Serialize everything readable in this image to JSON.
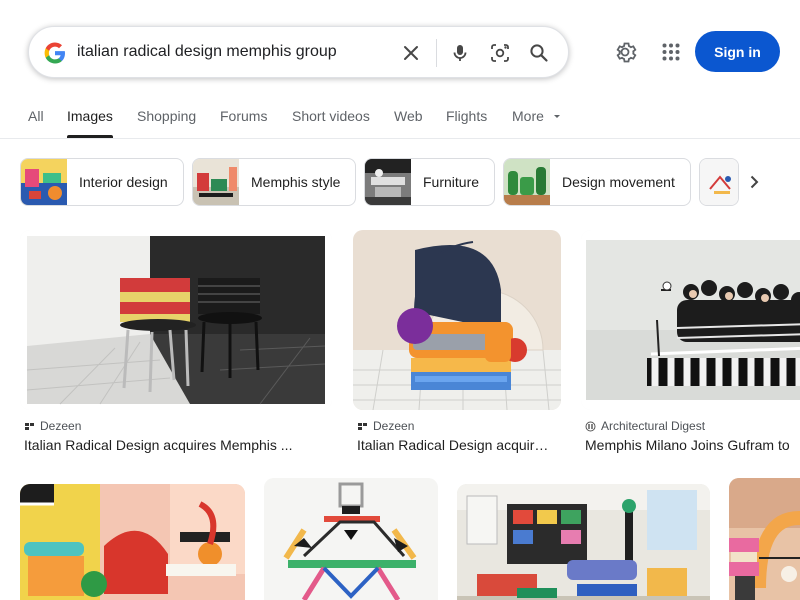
{
  "search": {
    "query": "italian radical design memphis group"
  },
  "header": {
    "signin_label": "Sign in"
  },
  "tabs": [
    {
      "label": "All"
    },
    {
      "label": "Images"
    },
    {
      "label": "Shopping"
    },
    {
      "label": "Forums"
    },
    {
      "label": "Short videos"
    },
    {
      "label": "Web"
    },
    {
      "label": "Flights"
    },
    {
      "label": "More"
    }
  ],
  "chips": [
    {
      "label": "Interior design"
    },
    {
      "label": "Memphis style"
    },
    {
      "label": "Furniture"
    },
    {
      "label": "Design movement"
    }
  ],
  "results": [
    {
      "source": "Dezeen",
      "title": "Italian Radical Design acquires Memphis ..."
    },
    {
      "source": "Dezeen",
      "title": "Italian Radical Design acquir…"
    },
    {
      "source": "Architectural Digest",
      "title": "Memphis Milano Joins Gufram to"
    }
  ],
  "colors": {
    "accent": "#0b57d0",
    "active_tab": "#1f1f1f",
    "muted": "#5f6368"
  },
  "icons": [
    "google-g-icon",
    "clear-icon",
    "mic-icon",
    "lens-icon",
    "search-icon",
    "gear-icon",
    "apps-grid-icon",
    "chevron-right-icon",
    "dropdown-caret-icon"
  ]
}
